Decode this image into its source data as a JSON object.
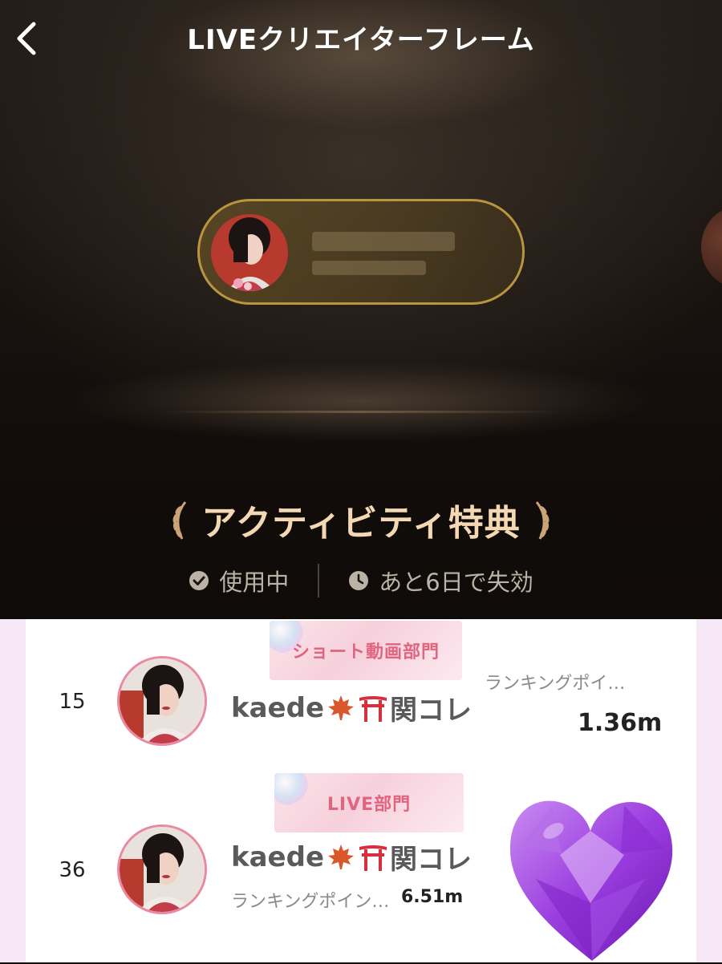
{
  "header": {
    "title": "LIVEクリエイターフレーム"
  },
  "benefit": {
    "title": "アクティビティ特典",
    "status_in_use": "使用中",
    "status_expiry": "あと6日で失効"
  },
  "rankings": [
    {
      "rank": "15",
      "category": "ショート動画部門",
      "username": "kaede",
      "username_suffix": "関コレ",
      "points_label": "ランキングポイ…",
      "points_value": "1.36m"
    },
    {
      "rank": "36",
      "category": "LIVE部門",
      "username": "kaede",
      "username_suffix": "関コレ",
      "points_label": "ランキングポイン…",
      "points_value": "6.51m"
    }
  ],
  "icons": {
    "back": "chevron-left-icon",
    "check": "check-circle-icon",
    "clock": "clock-icon",
    "maple": "maple-leaf-icon",
    "torii": "torii-gate-icon",
    "laurel": "laurel-icon",
    "heart": "purple-heart-gem"
  },
  "colors": {
    "gold_border": "#b8963f",
    "benefit_title": "#f3d8b3",
    "banner_text": "#e0657e",
    "avatar_ring": "#e88aa2"
  }
}
